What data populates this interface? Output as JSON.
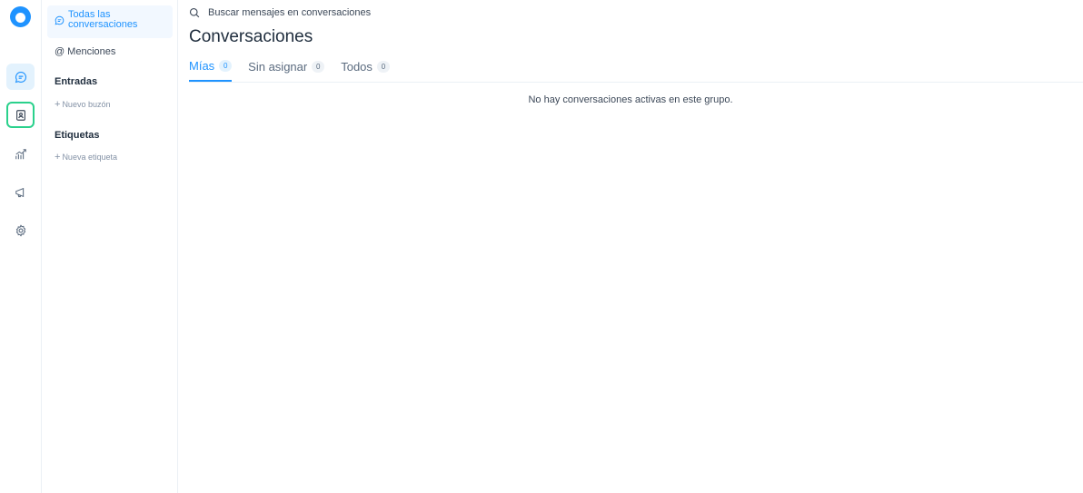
{
  "rail": {
    "logo": "chatwoot-logo",
    "items": [
      {
        "icon": "chat-bubble-icon",
        "state": "active"
      },
      {
        "icon": "contacts-icon",
        "state": "focused"
      },
      {
        "icon": "reports-icon"
      },
      {
        "icon": "campaigns-megaphone-icon"
      },
      {
        "icon": "settings-gear-icon"
      }
    ]
  },
  "sidebar": {
    "all_conversations": "Todas las conversaciones",
    "mentions": "Menciones",
    "inboxes_heading": "Entradas",
    "new_inbox": "Nuevo buzón",
    "labels_heading": "Etiquetas",
    "new_label": "Nueva etiqueta"
  },
  "main": {
    "search_placeholder": "Buscar mensajes en conversaciones",
    "title": "Conversaciones",
    "tabs": [
      {
        "label": "Mías",
        "count": "0"
      },
      {
        "label": "Sin asignar",
        "count": "0"
      },
      {
        "label": "Todos",
        "count": "0"
      }
    ],
    "empty_message": "No hay conversaciones activas en este grupo."
  },
  "colors": {
    "accent": "#1f93ff",
    "focus_ring": "#2ad18c"
  }
}
